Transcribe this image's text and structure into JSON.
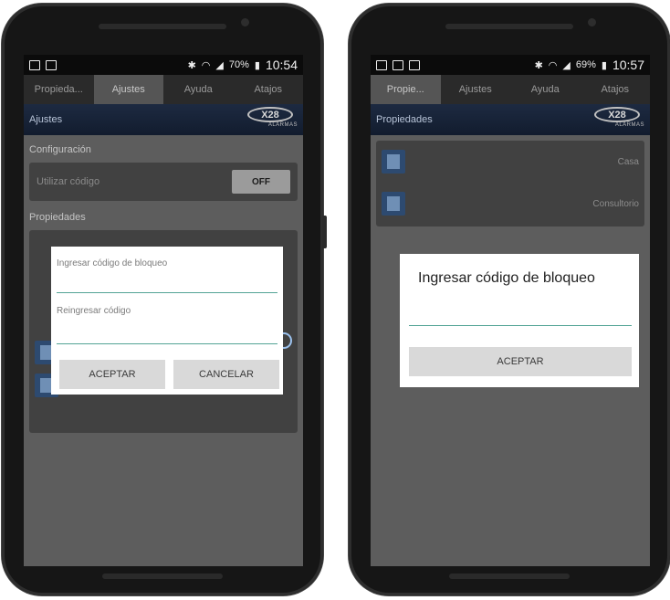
{
  "left": {
    "status": {
      "time": "10:54",
      "battery": "70%"
    },
    "tabs": [
      {
        "label": "Propieda..."
      },
      {
        "label": "Ajustes"
      },
      {
        "label": "Ayuda"
      },
      {
        "label": "Atajos"
      }
    ],
    "header": {
      "title": "Ajustes",
      "logo_main": "X28",
      "logo_sub": "ALARMAS"
    },
    "config_section": "Configuración",
    "toggle_label": "Utilizar código",
    "toggle_value": "OFF",
    "props_section": "Propiedades",
    "dialog": {
      "field1_placeholder": "Ingresar código de bloqueo",
      "field2_placeholder": "Reingresar código",
      "accept": "ACEPTAR",
      "cancel": "CANCELAR"
    }
  },
  "right": {
    "status": {
      "time": "10:57",
      "battery": "69%"
    },
    "tabs": [
      {
        "label": "Propie..."
      },
      {
        "label": "Ajustes"
      },
      {
        "label": "Ayuda"
      },
      {
        "label": "Atajos"
      }
    ],
    "header": {
      "title": "Propiedades",
      "logo_main": "X28",
      "logo_sub": "ALARMAS"
    },
    "properties": [
      {
        "name": "Casa"
      },
      {
        "name": "Consultorio"
      }
    ],
    "dialog": {
      "title": "Ingresar código de bloqueo",
      "accept": "ACEPTAR"
    }
  }
}
